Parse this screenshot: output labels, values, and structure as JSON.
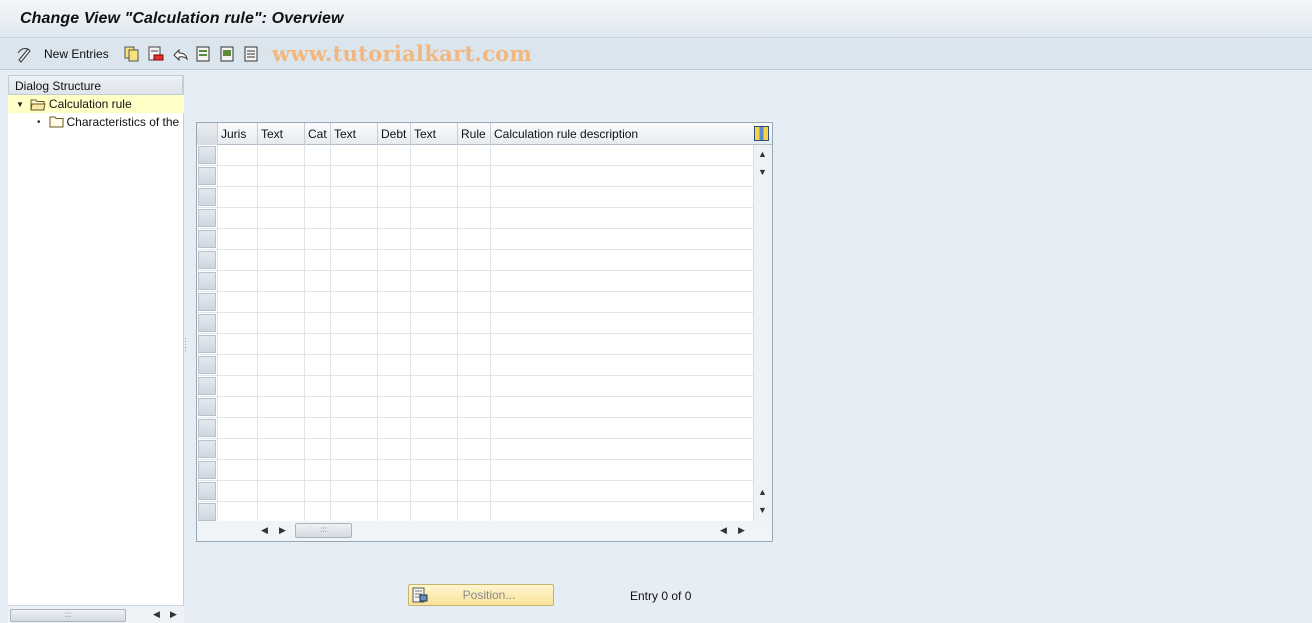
{
  "window": {
    "title": "Change View \"Calculation rule\": Overview"
  },
  "toolbar": {
    "new_entries_label": "New Entries",
    "icons": [
      "edit-pen-icon",
      "copy-icon",
      "delete-icon",
      "undo-icon",
      "select-all-icon",
      "select-block-icon",
      "deselect-all-icon"
    ],
    "watermark": "www.tutorialkart.com"
  },
  "dialog_structure": {
    "header": "Dialog Structure",
    "items": [
      {
        "label": "Calculation rule",
        "selected": true,
        "expanded": true
      },
      {
        "label": "Characteristics of the"
      }
    ]
  },
  "table": {
    "columns": [
      "Juris",
      "Text",
      "Cat",
      "Text",
      "Debt",
      "Text",
      "Rule",
      "Calculation rule description"
    ],
    "rows": [],
    "visible_empty_rows": 18
  },
  "footer": {
    "position_label": "Position...",
    "entry_text": "Entry 0 of 0"
  },
  "colors": {
    "accent": "#f7e39a",
    "selected_tree_bg": "#ffffc8",
    "watermark": "#f2b77f",
    "background": "#e6edf4"
  }
}
